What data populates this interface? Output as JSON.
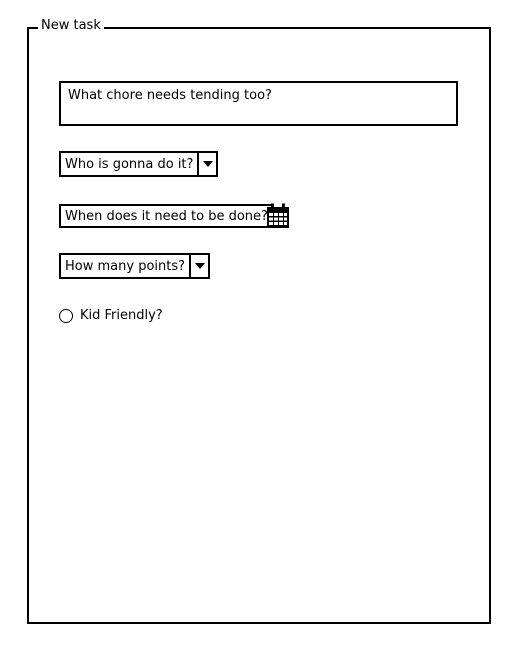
{
  "form": {
    "legend": "New task",
    "chore_placeholder": "What chore needs tending too?",
    "assignee_placeholder": "Who is gonna do it?",
    "due_placeholder": "When does it need to be done?",
    "points_placeholder": "How many points?",
    "kid_friendly_label": "Kid Friendly?"
  },
  "icons": {
    "calendar": "calendar-icon",
    "dropdown": "chevron-down-icon",
    "radio": "radio-button"
  },
  "colors": {
    "ink": "#000000",
    "background": "#ffffff"
  }
}
